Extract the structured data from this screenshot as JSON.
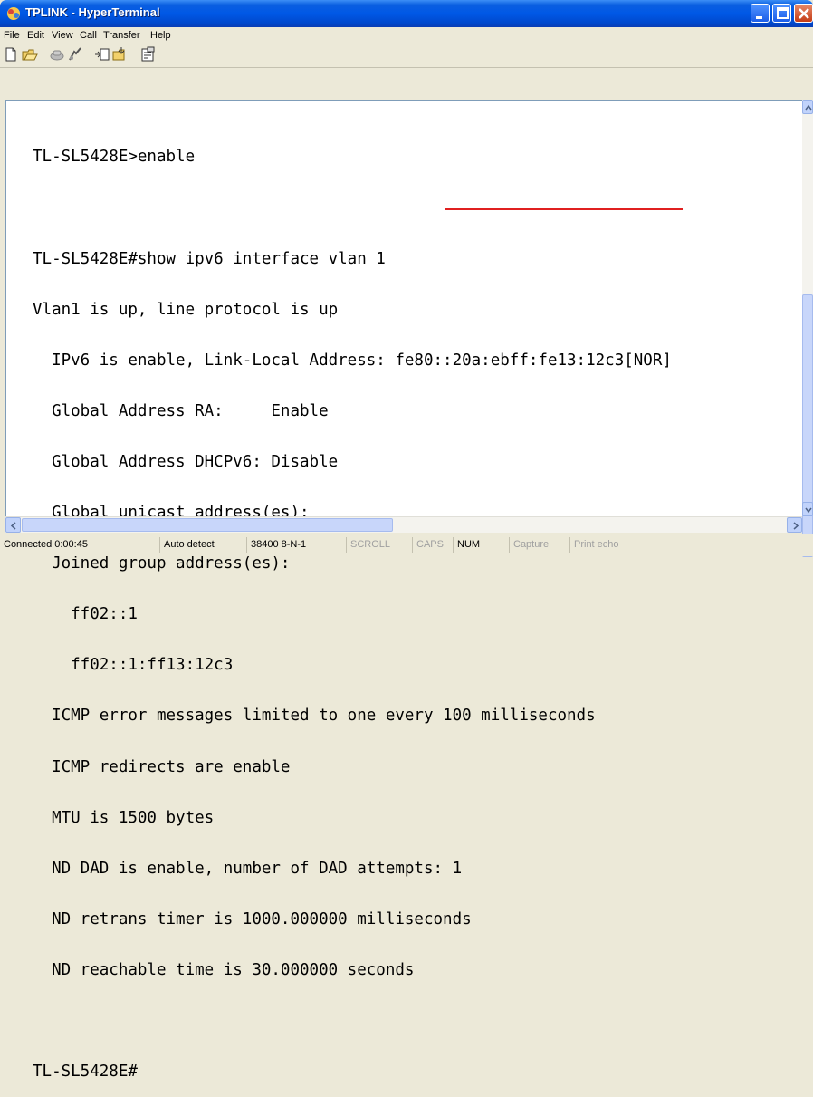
{
  "window": {
    "title": "TPLINK - HyperTerminal"
  },
  "menu": [
    "File",
    "Edit",
    "View",
    "Call",
    "Transfer",
    "Help"
  ],
  "toolbar": {
    "icons": [
      "new-icon",
      "open-icon",
      "call-icon",
      "disconnect-icon",
      "send-icon",
      "receive-icon",
      "properties-icon"
    ]
  },
  "terminal": {
    "lines": [
      "TL-SL5428E>enable",
      "",
      "TL-SL5428E#show ipv6 interface vlan 1",
      "Vlan1 is up, line protocol is up",
      "  IPv6 is enable, Link-Local Address: fe80::20a:ebff:fe13:12c3[NOR]",
      "  Global Address RA:     Enable",
      "  Global Address DHCPv6: Disable",
      "  Global unicast address(es):",
      "  Joined group address(es):",
      "    ff02::1",
      "    ff02::1:ff13:12c3",
      "  ICMP error messages limited to one every 100 milliseconds",
      "  ICMP redirects are enable",
      "  MTU is 1500 bytes",
      "  ND DAD is enable, number of DAD attempts: 1",
      "  ND retrans timer is 1000.000000 milliseconds",
      "  ND reachable time is 30.000000 seconds",
      "",
      "TL-SL5428E#"
    ],
    "highlight_color": "#e02020"
  },
  "status": {
    "connected": "Connected 0:00:45",
    "detect": "Auto detect",
    "settings": "38400 8-N-1",
    "scroll": "SCROLL",
    "caps": "CAPS",
    "num": "NUM",
    "capture": "Capture",
    "print_echo": "Print echo"
  }
}
